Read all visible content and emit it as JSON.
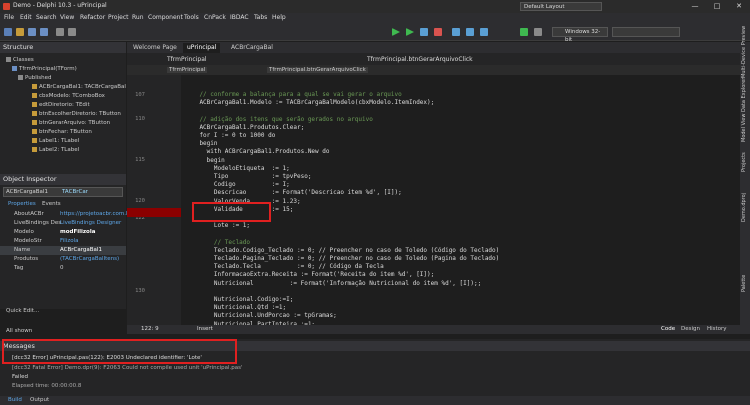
{
  "window": {
    "title": "Demo - Delphi 10.3 - uPrincipal",
    "layout_value": "Default Layout"
  },
  "menu": [
    "File",
    "Edit",
    "Search",
    "View",
    "Refactor",
    "Project",
    "Run",
    "Component",
    "Tools",
    "CnPack",
    "IBDAC",
    "Tabs",
    "Help"
  ],
  "toolbar": {
    "platform": "Windows 32-bit"
  },
  "structure": {
    "title": "Structure",
    "items": [
      "Classes",
      "TfrmPrincipal(TForm)",
      "Published",
      "ACBrCargaBal1: TACBrCargaBal",
      "cbxModelo: TComboBox",
      "edtDiretorio: TEdit",
      "btnEscolherDiretorio: TButton",
      "btnGerarArquivo: TButton",
      "btnFechar: TButton",
      "Label1: TLabel",
      "Label2: TLabel"
    ]
  },
  "inspector": {
    "title": "Object Inspector",
    "selected": "ACBrCargaBal1",
    "selected_type": "TACBrCar",
    "tabs": [
      "Properties",
      "Events"
    ],
    "rows": [
      {
        "key": "AboutACBr",
        "val": "https://projetoacbr.com.br/"
      },
      {
        "key": "LiveBindings Des",
        "val": "LiveBindings Designer"
      },
      {
        "key": "Modelo",
        "val": "modFilizola"
      },
      {
        "key": "ModeloStr",
        "val": "Filizola"
      },
      {
        "key": "Name",
        "val": "ACBrCargaBal1"
      },
      {
        "key": "Produtos",
        "val": "(TACBrCargaBalItens)"
      },
      {
        "key": "Tag",
        "val": "0"
      }
    ],
    "quick_edit": "Quick Edit...",
    "all_shown": "All shown"
  },
  "editor": {
    "tabs": [
      "Welcome Page",
      "uPrincipal",
      "ACBrCargaBal"
    ],
    "nav_left": "TfrmPrincipal",
    "nav_right": "TfrmPrincipal.btnGerarArquivoClick",
    "nav2_left": "TfrmPrincipal",
    "nav2_right": "TfrmPrincipal.btnGerarArquivoClick",
    "lines": [
      {
        "n": "107",
        "t": "    // conforme a balança para a qual se vai gerar o arquivo",
        "c": true
      },
      {
        "n": "",
        "t": "    ACBrCargaBal1.Modelo := TACBrCargaBalModelo(cbxModelo.ItemIndex);",
        "c": false
      },
      {
        "n": "",
        "t": "",
        "c": false
      },
      {
        "n": "110",
        "t": "    // adição dos itens que serão gerados no arquivo",
        "c": true
      },
      {
        "n": "",
        "t": "    ACBrCargaBal1.Produtos.Clear;",
        "c": false
      },
      {
        "n": "",
        "t": "    for I := 0 to 1000 do",
        "c": false
      },
      {
        "n": "",
        "t": "    begin",
        "c": false
      },
      {
        "n": "",
        "t": "      with ACBrCargaBal1.Produtos.New do",
        "c": false
      },
      {
        "n": "115",
        "t": "      begin",
        "c": false
      },
      {
        "n": "",
        "t": "        ModeloEtiqueta  := 1;",
        "c": false
      },
      {
        "n": "",
        "t": "        Tipo            := tpvPeso;",
        "c": false
      },
      {
        "n": "",
        "t": "        Codigo          := I;",
        "c": false
      },
      {
        "n": "",
        "t": "        Descricao       := Format('Descricao item %d', [I]);",
        "c": false
      },
      {
        "n": "120",
        "t": "        ValorVenda      := 1.23;",
        "c": false
      },
      {
        "n": "",
        "t": "        Validade        := 15;",
        "c": false
      },
      {
        "n": "122",
        "t": "",
        "c": false
      },
      {
        "n": "",
        "t": "        Lote := 1;",
        "c": false
      },
      {
        "n": "",
        "t": "",
        "c": false
      },
      {
        "n": "",
        "t": "        // Teclado",
        "c": true
      },
      {
        "n": "",
        "t": "        Teclado.Codigo_Teclado := 0; // Preencher no caso de Toledo (Código do Teclado)",
        "c": false
      },
      {
        "n": "",
        "t": "        Teclado.Pagina_Teclado := 0; // Preencher no caso de Toledo (Pagina do Teclado)",
        "c": false
      },
      {
        "n": "",
        "t": "        Teclado.Tecla          := 0; // Código da Tecla",
        "c": false
      },
      {
        "n": "",
        "t": "        InformacaoExtra.Receita := Format('Receita do item %d', [I]);",
        "c": false
      },
      {
        "n": "",
        "t": "        Nutricional          := Format('Informação Nutricional do item %d', [I]);;",
        "c": false
      },
      {
        "n": "130",
        "t": "",
        "c": false
      },
      {
        "n": "",
        "t": "        Nutricional.Codigo:=I;",
        "c": false
      },
      {
        "n": "",
        "t": "        Nutricional.Qtd :=1;",
        "c": false
      },
      {
        "n": "",
        "t": "        Nutricional.UndPorcao := tpGramas;",
        "c": false
      },
      {
        "n": "",
        "t": "        Nutricional.PartInteira :=1;",
        "c": false
      },
      {
        "n": "",
        "t": "        Nutricional.PartDecimal:= tpParal2;",
        "c": false
      },
      {
        "n": "",
        "t": "        Nutricional.MedCaseira := tpColherSopa;",
        "c": false
      }
    ],
    "status_pos": "122: 9",
    "status_mode": "Insert",
    "view_tabs": [
      "Code",
      "Design",
      "History"
    ]
  },
  "messages": {
    "title": "Messages",
    "lines": [
      "[dcc32 Error] uPrincipal.pas(122): E2003 Undeclared identifier: 'Lote'",
      "[dcc32 Fatal Error] Demo.dpr(9): F2063 Could not compile used unit 'uPrincipal.pas'",
      "Failed",
      "Elapsed time: 00:00:00.8"
    ],
    "tabs": [
      "Build",
      "Output"
    ]
  },
  "right_tabs": [
    "Projects",
    "Model View",
    "Data Explorer",
    "Multi-Device Preview",
    "Palette",
    "Demo.dproj"
  ]
}
